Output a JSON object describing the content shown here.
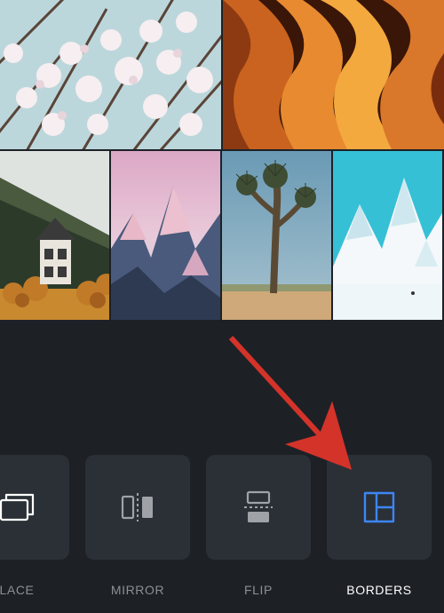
{
  "collage": {
    "top_row": [
      {
        "name": "cherry-blossoms"
      },
      {
        "name": "slot-canyon"
      }
    ],
    "bottom_row": [
      {
        "name": "house-autumn-forest"
      },
      {
        "name": "alpine-sunset"
      },
      {
        "name": "joshua-tree"
      },
      {
        "name": "snowy-peak"
      }
    ]
  },
  "tools": [
    {
      "id": "replace",
      "label": "LACE",
      "icon": "replace-icon",
      "selected": false
    },
    {
      "id": "mirror",
      "label": "MIRROR",
      "icon": "mirror-icon",
      "selected": false
    },
    {
      "id": "flip",
      "label": "FLIP",
      "icon": "flip-icon",
      "selected": false
    },
    {
      "id": "borders",
      "label": "BORDERS",
      "icon": "borders-icon",
      "selected": true
    }
  ],
  "colors": {
    "accent": "#3d86f5",
    "panel": "#2b3036",
    "bg": "#1d2126",
    "muted": "#8c8f93",
    "text": "#ffffff",
    "arrow": "#d4332a"
  },
  "annotation": {
    "type": "arrow",
    "target_tool": "borders"
  }
}
